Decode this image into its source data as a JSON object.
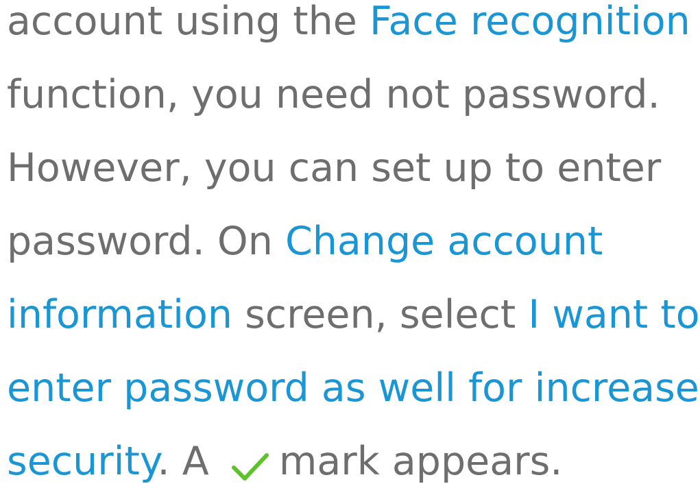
{
  "paragraph": {
    "line1": {
      "text_a": "account using the ",
      "link_a": "Face recognition"
    },
    "line2": {
      "text_a": "function, you need not password."
    },
    "line3": {
      "text_a": "However, you can set up to enter"
    },
    "line4": {
      "text_a": "password. On ",
      "link_a": "Change account"
    },
    "line5": {
      "link_a": "information",
      "text_a": " screen, select ",
      "link_b": "I want to"
    },
    "line6": {
      "link_a": "enter password as well for increased"
    },
    "line7": {
      "link_a": "security",
      "text_a": ". A ",
      "icon": "check-mark-icon",
      "text_b": "mark appears."
    }
  },
  "colors": {
    "body_text": "#6e6e6e",
    "highlight": "#1a96d4",
    "check": "#5ec22a"
  }
}
